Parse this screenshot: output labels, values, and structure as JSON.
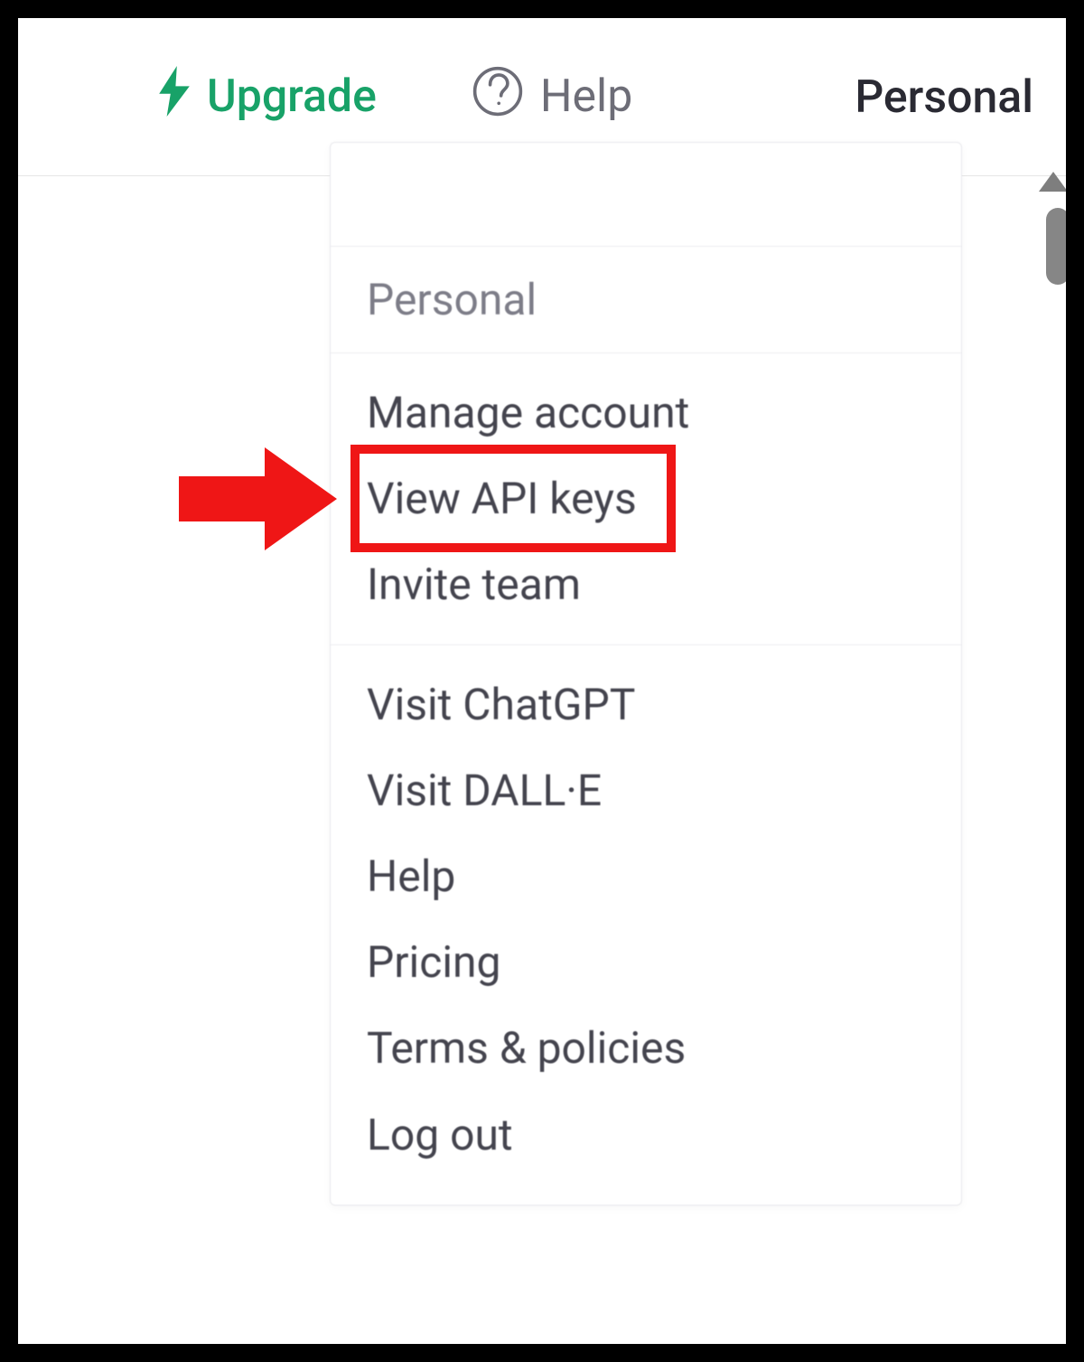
{
  "topbar": {
    "upgrade_label": "Upgrade",
    "help_label": "Help",
    "personal_label": "Personal"
  },
  "menu": {
    "header": "Personal",
    "group1": [
      "Manage account",
      "View API keys",
      "Invite team"
    ],
    "group2": [
      "Visit ChatGPT",
      "Visit DALL·E",
      "Help",
      "Pricing",
      "Terms & policies",
      "Log out"
    ],
    "highlighted_item": "View API keys"
  },
  "colors": {
    "accent_green": "#18a268",
    "annotation_red": "#ef1616"
  }
}
